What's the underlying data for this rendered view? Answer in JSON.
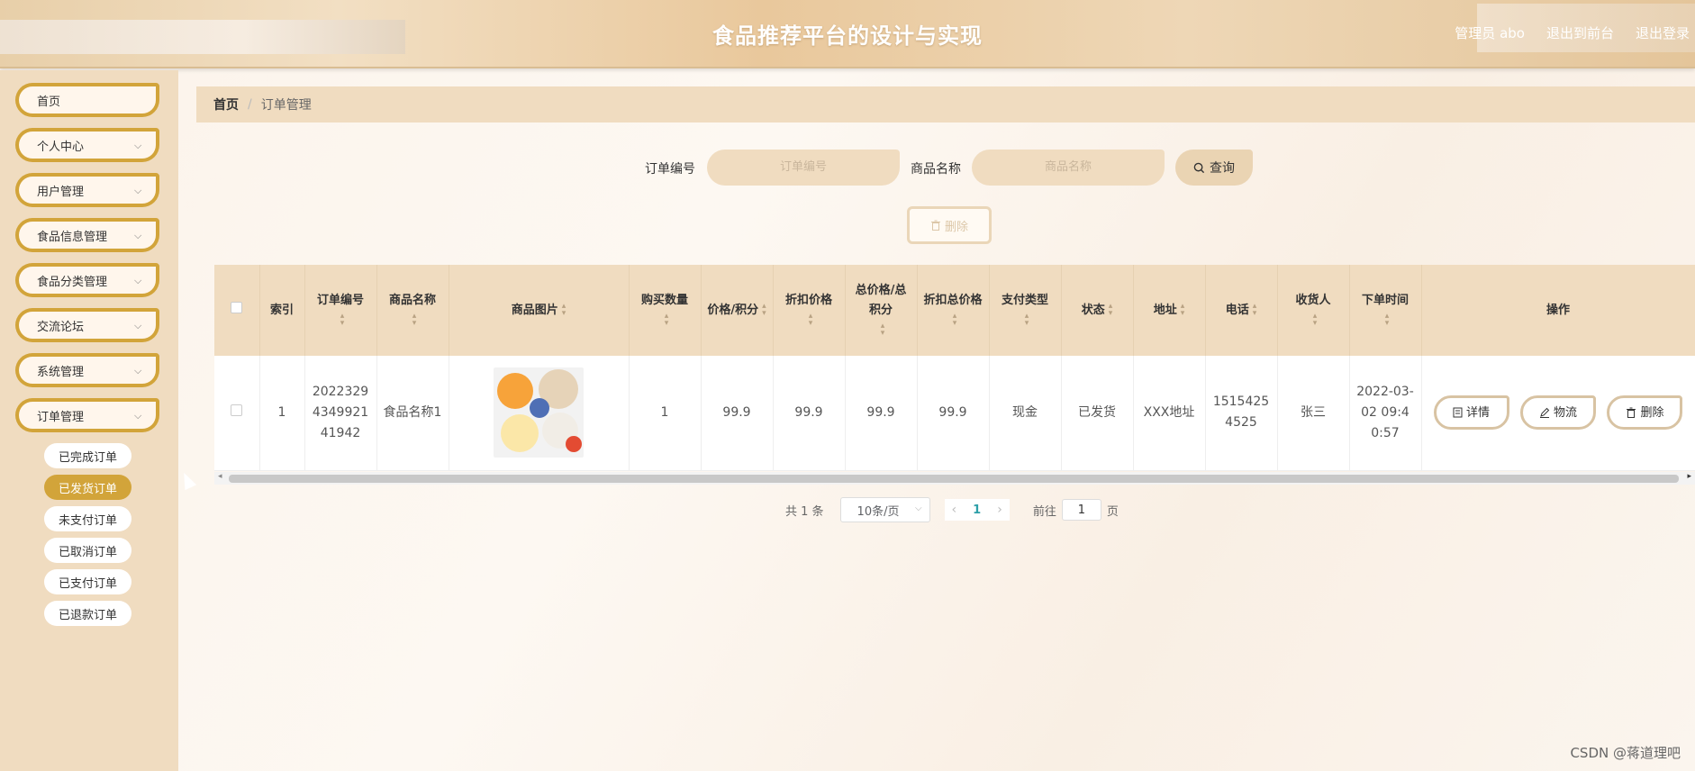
{
  "header": {
    "title": "食品推荐平台的设计与实现",
    "user": "管理员 abo",
    "front": "退出到前台",
    "logout": "退出登录"
  },
  "sidebar": {
    "items": [
      {
        "label": "首页"
      },
      {
        "label": "个人中心"
      },
      {
        "label": "用户管理"
      },
      {
        "label": "食品信息管理"
      },
      {
        "label": "食品分类管理"
      },
      {
        "label": "交流论坛"
      },
      {
        "label": "系统管理"
      },
      {
        "label": "订单管理"
      }
    ],
    "sub_items": [
      {
        "label": "已完成订单"
      },
      {
        "label": "已发货订单"
      },
      {
        "label": "未支付订单"
      },
      {
        "label": "已取消订单"
      },
      {
        "label": "已支付订单"
      },
      {
        "label": "已退款订单"
      }
    ]
  },
  "breadcrumb": {
    "home": "首页",
    "sep": "/",
    "current": "订单管理"
  },
  "search": {
    "order_label": "订单编号",
    "order_placeholder": "订单编号",
    "name_label": "商品名称",
    "name_placeholder": "商品名称",
    "button": "查询",
    "delete": "删除"
  },
  "table": {
    "headers": [
      "索引",
      "订单编号",
      "商品名称",
      "商品图片",
      "购买数量",
      "价格/积分",
      "折扣价格",
      "总价格/总积分",
      "折扣总价格",
      "支付类型",
      "状态",
      "地址",
      "电话",
      "收货人",
      "下单时间",
      "操作"
    ],
    "rows": [
      {
        "index": "1",
        "order_no": "20223294349921 41942",
        "name": "食品名称1",
        "qty": "1",
        "price": "99.9",
        "disc_price": "99.9",
        "total": "99.9",
        "disc_total": "99.9",
        "pay_type": "现金",
        "status": "已发货",
        "address": "XXX地址",
        "phone": "15154254525",
        "receiver": "张三",
        "time": "2022-03-02 09:40:57"
      }
    ],
    "ops": {
      "detail": "详情",
      "logistics": "物流",
      "delete": "删除"
    }
  },
  "pager": {
    "total": "共 1 条",
    "size": "10条/页",
    "page": "1",
    "goto": "前往",
    "goto_value": "1",
    "page_unit": "页"
  },
  "watermark": "CSDN @蒋道理吧",
  "colors": {
    "accent": "#d2a43a",
    "panel": "#f0dcc0"
  }
}
